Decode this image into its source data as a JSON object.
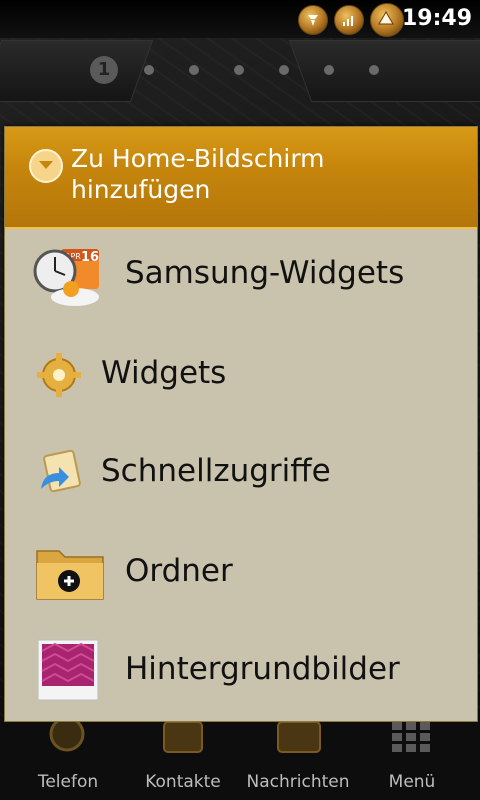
{
  "status_bar": {
    "time": "19:49",
    "icons": [
      "usb-icon",
      "signal-icon",
      "notification-icon"
    ]
  },
  "home": {
    "current_page": "1",
    "page_count": 7
  },
  "dialog": {
    "title": "Zu Home-Bildschirm hinzufügen",
    "title_line1": "Zu Home-Bildschirm",
    "title_line2": "hinzufügen",
    "items": [
      {
        "label": "Samsung-Widgets",
        "icon": "clock-calendar-icon"
      },
      {
        "label": "Widgets",
        "icon": "gear-icon"
      },
      {
        "label": "Schnellzugriffe",
        "icon": "shortcut-arrow-icon"
      },
      {
        "label": "Ordner",
        "icon": "folder-add-icon"
      },
      {
        "label": "Hintergrundbilder",
        "icon": "wallpaper-icon"
      }
    ],
    "calendar_badge": {
      "month": "APR",
      "day": "16"
    }
  },
  "dock": {
    "items": [
      {
        "label": "Telefon",
        "icon": "phone-icon"
      },
      {
        "label": "Kontakte",
        "icon": "contacts-icon"
      },
      {
        "label": "Nachrichten",
        "icon": "messages-icon"
      },
      {
        "label": "Menü",
        "icon": "menu-grid-icon"
      }
    ]
  },
  "colors": {
    "header_gold": "#c6860c",
    "dialog_bg": "#c9c3ae",
    "wallpaper": "#141414"
  }
}
